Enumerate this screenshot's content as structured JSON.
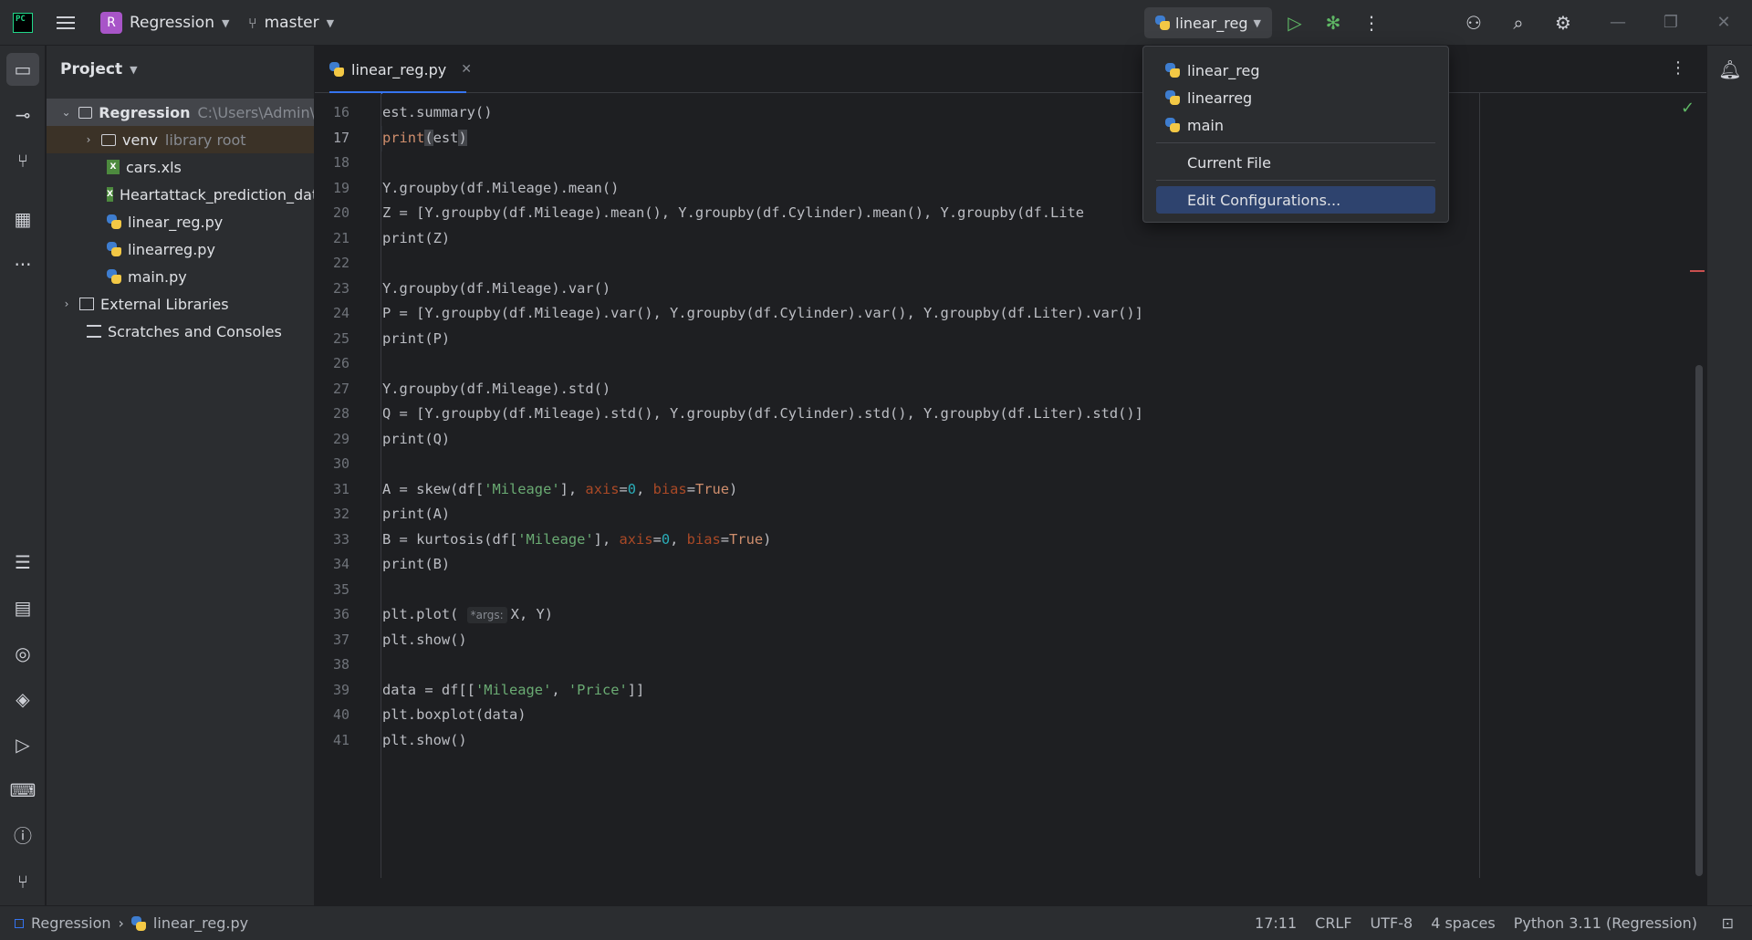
{
  "titlebar": {
    "project_badge": "R",
    "project_name": "Regression",
    "branch": "master",
    "run_config": "linear_reg"
  },
  "project_panel": {
    "title": "Project",
    "tree": [
      {
        "label": "Regression",
        "extra": "C:\\Users\\Admin\\",
        "icon": "folder-icon",
        "expanded": true
      },
      {
        "label": "venv",
        "extra": "library root",
        "icon": "folder-icon",
        "expanded": false
      },
      {
        "label": "cars.xls",
        "icon": "xls-file-icon"
      },
      {
        "label": "Heartattack_prediction_dat",
        "icon": "xls-file-icon"
      },
      {
        "label": "linear_reg.py",
        "icon": "python-file-icon"
      },
      {
        "label": "linearreg.py",
        "icon": "python-file-icon"
      },
      {
        "label": "main.py",
        "icon": "python-file-icon"
      },
      {
        "label": "External Libraries",
        "icon": "library-icon",
        "expanded": false
      },
      {
        "label": "Scratches and Consoles",
        "icon": "scratches-icon"
      }
    ]
  },
  "editor": {
    "tab_label": "linear_reg.py",
    "current_line": 17,
    "lines": [
      {
        "n": "16",
        "code": "est.summary()"
      },
      {
        "n": "17",
        "code": "print(est)"
      },
      {
        "n": "18",
        "code": ""
      },
      {
        "n": "19",
        "code": "Y.groupby(df.Mileage).mean()"
      },
      {
        "n": "20",
        "code": "Z = [Y.groupby(df.Mileage).mean(), Y.groupby(df.Cylinder).mean(), Y.groupby(df.Lite"
      },
      {
        "n": "21",
        "code": "print(Z)"
      },
      {
        "n": "22",
        "code": ""
      },
      {
        "n": "23",
        "code": "Y.groupby(df.Mileage).var()"
      },
      {
        "n": "24",
        "code": "P = [Y.groupby(df.Mileage).var(), Y.groupby(df.Cylinder).var(), Y.groupby(df.Liter).var()]"
      },
      {
        "n": "25",
        "code": "print(P)"
      },
      {
        "n": "26",
        "code": ""
      },
      {
        "n": "27",
        "code": "Y.groupby(df.Mileage).std()"
      },
      {
        "n": "28",
        "code": "Q = [Y.groupby(df.Mileage).std(), Y.groupby(df.Cylinder).std(), Y.groupby(df.Liter).std()]"
      },
      {
        "n": "29",
        "code": "print(Q)"
      },
      {
        "n": "30",
        "code": ""
      },
      {
        "n": "31",
        "code": "A = skew(df['Mileage'], axis=0, bias=True)"
      },
      {
        "n": "32",
        "code": "print(A)"
      },
      {
        "n": "33",
        "code": "B = kurtosis(df['Mileage'], axis=0, bias=True)"
      },
      {
        "n": "34",
        "code": "print(B)"
      },
      {
        "n": "35",
        "code": ""
      },
      {
        "n": "36",
        "code": "plt.plot( *args: X, Y)"
      },
      {
        "n": "37",
        "code": "plt.show()"
      },
      {
        "n": "38",
        "code": ""
      },
      {
        "n": "39",
        "code": "data = df[['Mileage', 'Price']]"
      },
      {
        "n": "40",
        "code": "plt.boxplot(data)"
      },
      {
        "n": "41",
        "code": "plt.show()"
      }
    ]
  },
  "popup": {
    "items": [
      "linear_reg",
      "linearreg",
      "main"
    ],
    "current_file": "Current File",
    "edit_configs": "Edit Configurations..."
  },
  "statusbar": {
    "breadcrumb_project": "Regression",
    "breadcrumb_file": "linear_reg.py",
    "position": "17:11",
    "line_sep": "CRLF",
    "encoding": "UTF-8",
    "indent": "4 spaces",
    "interpreter": "Python 3.11 (Regression)"
  }
}
